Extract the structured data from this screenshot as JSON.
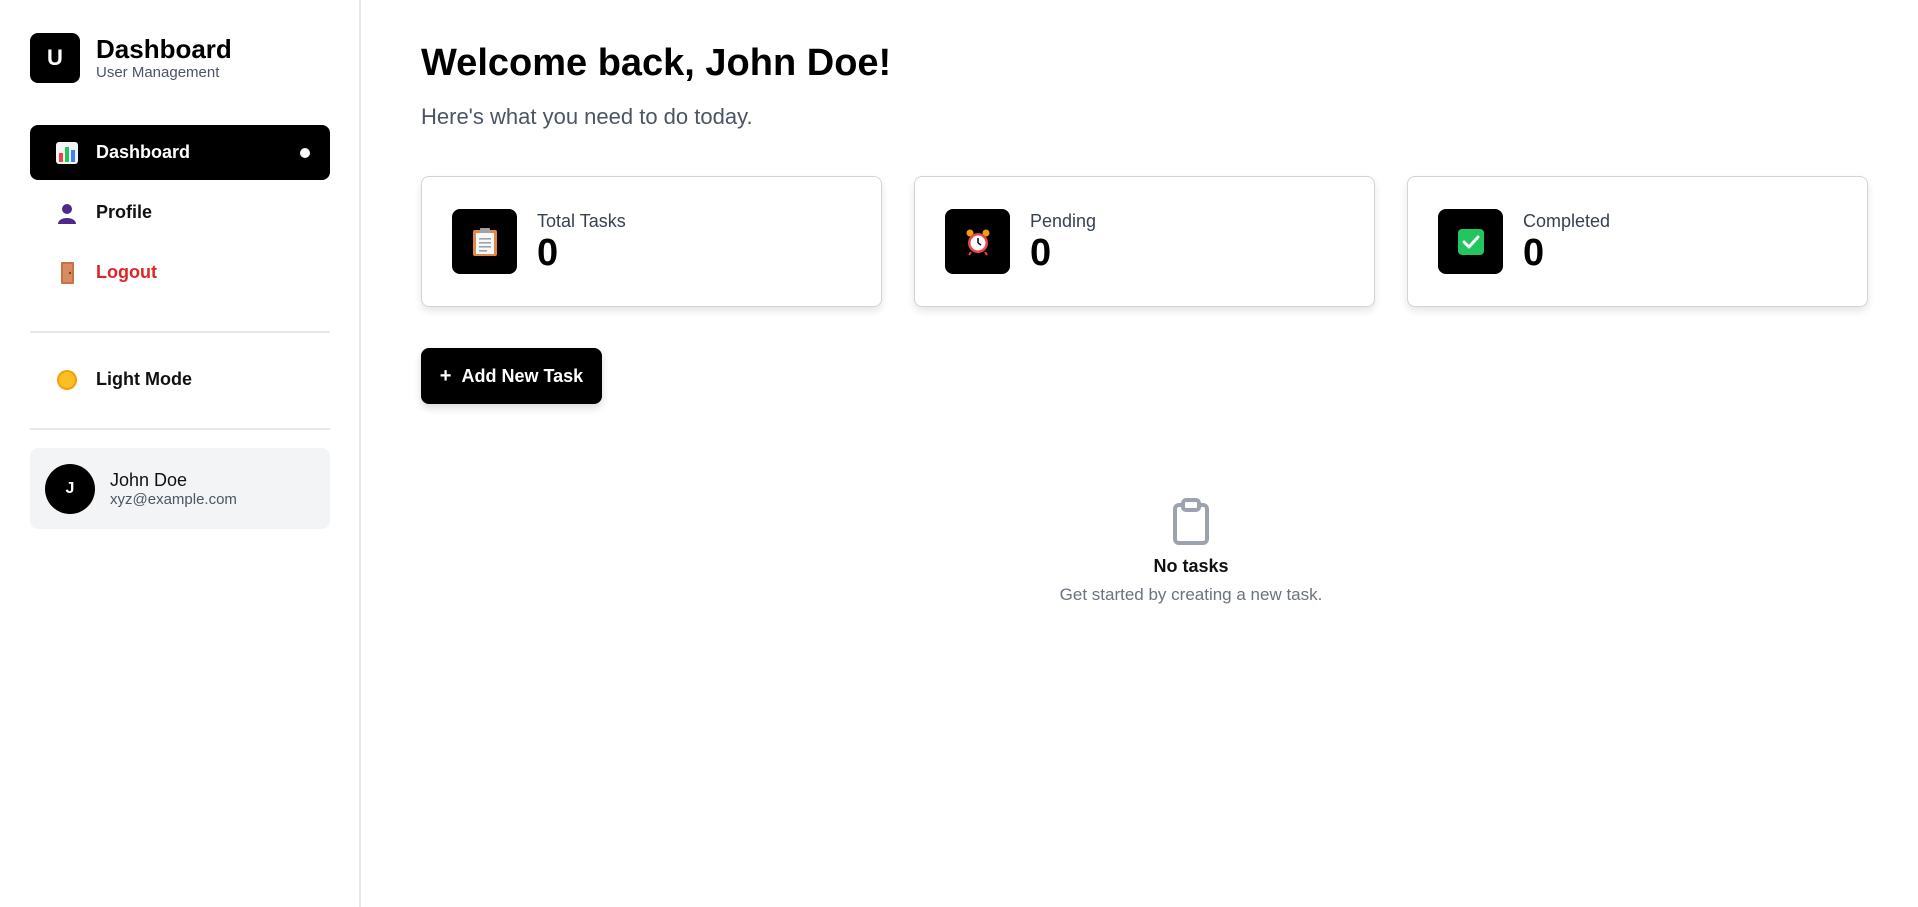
{
  "brand": {
    "logo_letter": "U",
    "title": "Dashboard",
    "subtitle": "User Management"
  },
  "nav": {
    "items": [
      {
        "label": "Dashboard",
        "icon": "chart-icon",
        "active": true
      },
      {
        "label": "Profile",
        "icon": "user-icon",
        "active": false
      },
      {
        "label": "Logout",
        "icon": "door-icon",
        "active": false
      }
    ]
  },
  "mode_toggle": {
    "label": "Light Mode",
    "icon": "sun-icon"
  },
  "user": {
    "initial": "J",
    "name": "John Doe",
    "email": "xyz@example.com"
  },
  "main": {
    "welcome": "Welcome back, John Doe!",
    "subtitle": "Here's what you need to do today.",
    "stats": [
      {
        "label": "Total Tasks",
        "value": "0",
        "icon": "clipboard-icon"
      },
      {
        "label": "Pending",
        "value": "0",
        "icon": "alarm-clock-icon"
      },
      {
        "label": "Completed",
        "value": "0",
        "icon": "check-box-icon"
      }
    ],
    "add_button": {
      "icon": "+",
      "label": "Add New Task"
    },
    "empty_state": {
      "title": "No tasks",
      "subtitle": "Get started by creating a new task.",
      "icon": "clipboard-outline-icon"
    }
  },
  "colors": {
    "accent": "#000000",
    "logout": "#dc2626",
    "muted": "#4b5563",
    "card_border": "#d1d5db",
    "user_card_bg": "#f3f4f6"
  }
}
